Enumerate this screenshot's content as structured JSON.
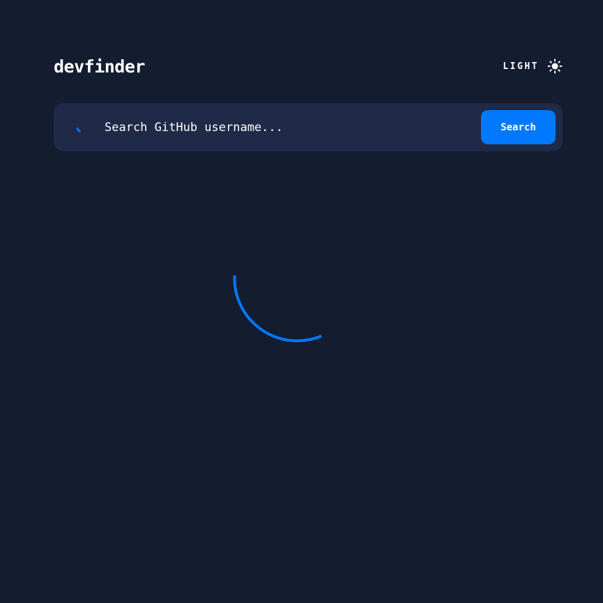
{
  "header": {
    "logo": "devfinder",
    "theme_toggle_label": "LIGHT",
    "theme_icon": "sun-icon"
  },
  "search": {
    "icon": "search-icon",
    "placeholder": "Search GitHub username...",
    "value": "",
    "button_label": "Search"
  },
  "loading": {
    "indicator": "spinner",
    "state": "loading"
  },
  "colors": {
    "background": "#141c2f",
    "card": "#1f2a48",
    "accent": "#0079ff",
    "text": "#ffffff"
  }
}
